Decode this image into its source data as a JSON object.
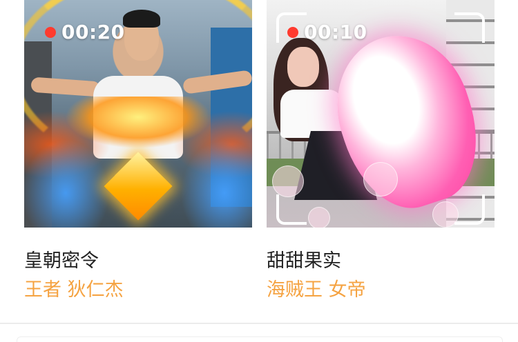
{
  "cards": [
    {
      "title": "皇朝密令",
      "subtitle": "王者 狄仁杰",
      "timer": "00:20",
      "rec_color": "#ff3b2f"
    },
    {
      "title": "甜甜果实",
      "subtitle": "海贼王 女帝",
      "timer": "00:10",
      "rec_color": "#ff3b2f"
    }
  ],
  "colors": {
    "subtitle": "#f5a342",
    "title": "#222222",
    "divider": "#ececec"
  }
}
